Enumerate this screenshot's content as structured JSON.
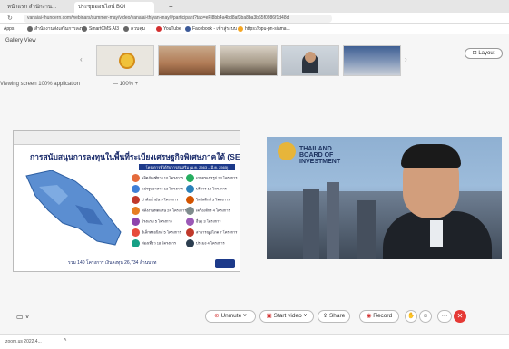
{
  "browser": {
    "tabs": [
      "หน้าแรก สำนักงาน...",
      "ประชุมออนไลน์ BOI",
      "+"
    ],
    "url": "vanaiai-thundern.com/webinars/summer-may/video/vanaiai-thiyan-may/#participant?tab=eFl8bb4a4bd8af3ba8ba3b65f0986f1d48d"
  },
  "bookmarks": [
    "Apps",
    "สำนักงานส่งเสริมการลงทุน",
    "SmartCMS AI3",
    "ควบคุม",
    "YouTube",
    "Facebook - เข้าสู่ระบบ",
    "https://ppu-pn-siama..."
  ],
  "meeting": {
    "title": "Gallery View",
    "layout_label": "Layout",
    "share_label": "Viewing screen 100% application",
    "zoom_label": "— 100% +",
    "slide_title": "การสนับสนุนการลงทุนในพื้นที่ระเบียงเศรษฐกิจพิเศษภาคใต้ (SEC)",
    "slide_sub": "โครงการที่ได้รับการส่งเสริม (ม.ค. 2563 – มี.ค. 2565)",
    "slide_footer": "รวม 140 โครงการ เงินลงทุน 26,734 ล้านบาท",
    "slide_items_left": [
      "ผลิตภัณฑ์ยาง 10 โครงการ",
      "แปรรูปอาหาร 13 โครงการ",
      "ปาล์มน้ำมัน 9 โครงการ",
      "พลังงานทดแทน 24 โครงการ",
      "โรงแรม 5 โครงการ",
      "อิเล็กทรอนิกส์ 5 โครงการ",
      "ท่องเที่ยว 18 โครงการ"
    ],
    "slide_items_right": [
      "เกษตรแปรรูป 23 โครงการ",
      "บริการ 12 โครงการ",
      "โลจิสติกส์ 3 โครงการ",
      "เครื่องจักร 4 โครงการ",
      "อื่นๆ 3 โครงการ",
      "สาธารณูปโภค 7 โครงการ",
      "ประมง 4 โครงการ"
    ],
    "boi_text_1": "THAILAND",
    "boi_text_2": "BOARD OF",
    "boi_text_3": "INVESTMENT"
  },
  "controls": {
    "unmute": "Unmute",
    "start_video": "Start video",
    "share": "Share",
    "record": "Record",
    "more": "···"
  },
  "status": {
    "text": "zoom.us 2022.4..."
  },
  "colors": {
    "end": "#e53935",
    "slide_title": "#1b2c6b"
  }
}
